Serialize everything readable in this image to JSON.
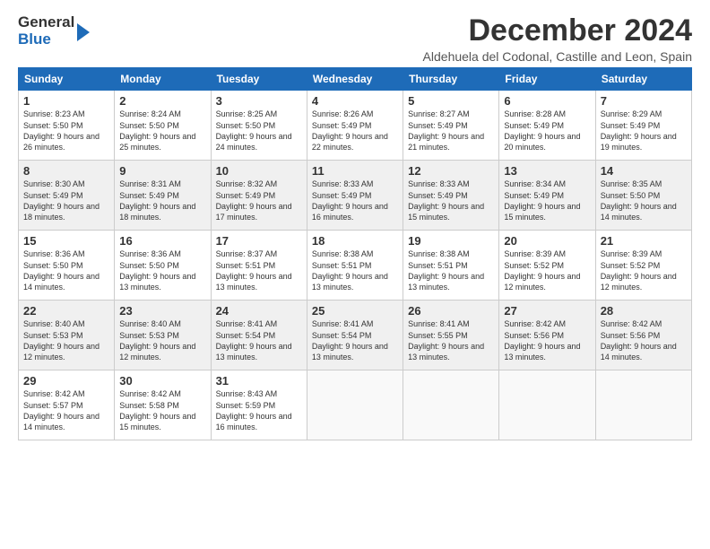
{
  "logo": {
    "general": "General",
    "blue": "Blue"
  },
  "title": {
    "month_year": "December 2024",
    "location": "Aldehuela del Codonal, Castille and Leon, Spain"
  },
  "headers": [
    "Sunday",
    "Monday",
    "Tuesday",
    "Wednesday",
    "Thursday",
    "Friday",
    "Saturday"
  ],
  "weeks": [
    [
      {
        "day": "1",
        "sunrise": "8:23 AM",
        "sunset": "5:50 PM",
        "daylight": "9 hours and 26 minutes."
      },
      {
        "day": "2",
        "sunrise": "8:24 AM",
        "sunset": "5:50 PM",
        "daylight": "9 hours and 25 minutes."
      },
      {
        "day": "3",
        "sunrise": "8:25 AM",
        "sunset": "5:50 PM",
        "daylight": "9 hours and 24 minutes."
      },
      {
        "day": "4",
        "sunrise": "8:26 AM",
        "sunset": "5:49 PM",
        "daylight": "9 hours and 22 minutes."
      },
      {
        "day": "5",
        "sunrise": "8:27 AM",
        "sunset": "5:49 PM",
        "daylight": "9 hours and 21 minutes."
      },
      {
        "day": "6",
        "sunrise": "8:28 AM",
        "sunset": "5:49 PM",
        "daylight": "9 hours and 20 minutes."
      },
      {
        "day": "7",
        "sunrise": "8:29 AM",
        "sunset": "5:49 PM",
        "daylight": "9 hours and 19 minutes."
      }
    ],
    [
      {
        "day": "8",
        "sunrise": "8:30 AM",
        "sunset": "5:49 PM",
        "daylight": "9 hours and 18 minutes."
      },
      {
        "day": "9",
        "sunrise": "8:31 AM",
        "sunset": "5:49 PM",
        "daylight": "9 hours and 18 minutes."
      },
      {
        "day": "10",
        "sunrise": "8:32 AM",
        "sunset": "5:49 PM",
        "daylight": "9 hours and 17 minutes."
      },
      {
        "day": "11",
        "sunrise": "8:33 AM",
        "sunset": "5:49 PM",
        "daylight": "9 hours and 16 minutes."
      },
      {
        "day": "12",
        "sunrise": "8:33 AM",
        "sunset": "5:49 PM",
        "daylight": "9 hours and 15 minutes."
      },
      {
        "day": "13",
        "sunrise": "8:34 AM",
        "sunset": "5:49 PM",
        "daylight": "9 hours and 15 minutes."
      },
      {
        "day": "14",
        "sunrise": "8:35 AM",
        "sunset": "5:50 PM",
        "daylight": "9 hours and 14 minutes."
      }
    ],
    [
      {
        "day": "15",
        "sunrise": "8:36 AM",
        "sunset": "5:50 PM",
        "daylight": "9 hours and 14 minutes."
      },
      {
        "day": "16",
        "sunrise": "8:36 AM",
        "sunset": "5:50 PM",
        "daylight": "9 hours and 13 minutes."
      },
      {
        "day": "17",
        "sunrise": "8:37 AM",
        "sunset": "5:51 PM",
        "daylight": "9 hours and 13 minutes."
      },
      {
        "day": "18",
        "sunrise": "8:38 AM",
        "sunset": "5:51 PM",
        "daylight": "9 hours and 13 minutes."
      },
      {
        "day": "19",
        "sunrise": "8:38 AM",
        "sunset": "5:51 PM",
        "daylight": "9 hours and 13 minutes."
      },
      {
        "day": "20",
        "sunrise": "8:39 AM",
        "sunset": "5:52 PM",
        "daylight": "9 hours and 12 minutes."
      },
      {
        "day": "21",
        "sunrise": "8:39 AM",
        "sunset": "5:52 PM",
        "daylight": "9 hours and 12 minutes."
      }
    ],
    [
      {
        "day": "22",
        "sunrise": "8:40 AM",
        "sunset": "5:53 PM",
        "daylight": "9 hours and 12 minutes."
      },
      {
        "day": "23",
        "sunrise": "8:40 AM",
        "sunset": "5:53 PM",
        "daylight": "9 hours and 12 minutes."
      },
      {
        "day": "24",
        "sunrise": "8:41 AM",
        "sunset": "5:54 PM",
        "daylight": "9 hours and 13 minutes."
      },
      {
        "day": "25",
        "sunrise": "8:41 AM",
        "sunset": "5:54 PM",
        "daylight": "9 hours and 13 minutes."
      },
      {
        "day": "26",
        "sunrise": "8:41 AM",
        "sunset": "5:55 PM",
        "daylight": "9 hours and 13 minutes."
      },
      {
        "day": "27",
        "sunrise": "8:42 AM",
        "sunset": "5:56 PM",
        "daylight": "9 hours and 13 minutes."
      },
      {
        "day": "28",
        "sunrise": "8:42 AM",
        "sunset": "5:56 PM",
        "daylight": "9 hours and 14 minutes."
      }
    ],
    [
      {
        "day": "29",
        "sunrise": "8:42 AM",
        "sunset": "5:57 PM",
        "daylight": "9 hours and 14 minutes."
      },
      {
        "day": "30",
        "sunrise": "8:42 AM",
        "sunset": "5:58 PM",
        "daylight": "9 hours and 15 minutes."
      },
      {
        "day": "31",
        "sunrise": "8:43 AM",
        "sunset": "5:59 PM",
        "daylight": "9 hours and 16 minutes."
      },
      null,
      null,
      null,
      null
    ]
  ]
}
